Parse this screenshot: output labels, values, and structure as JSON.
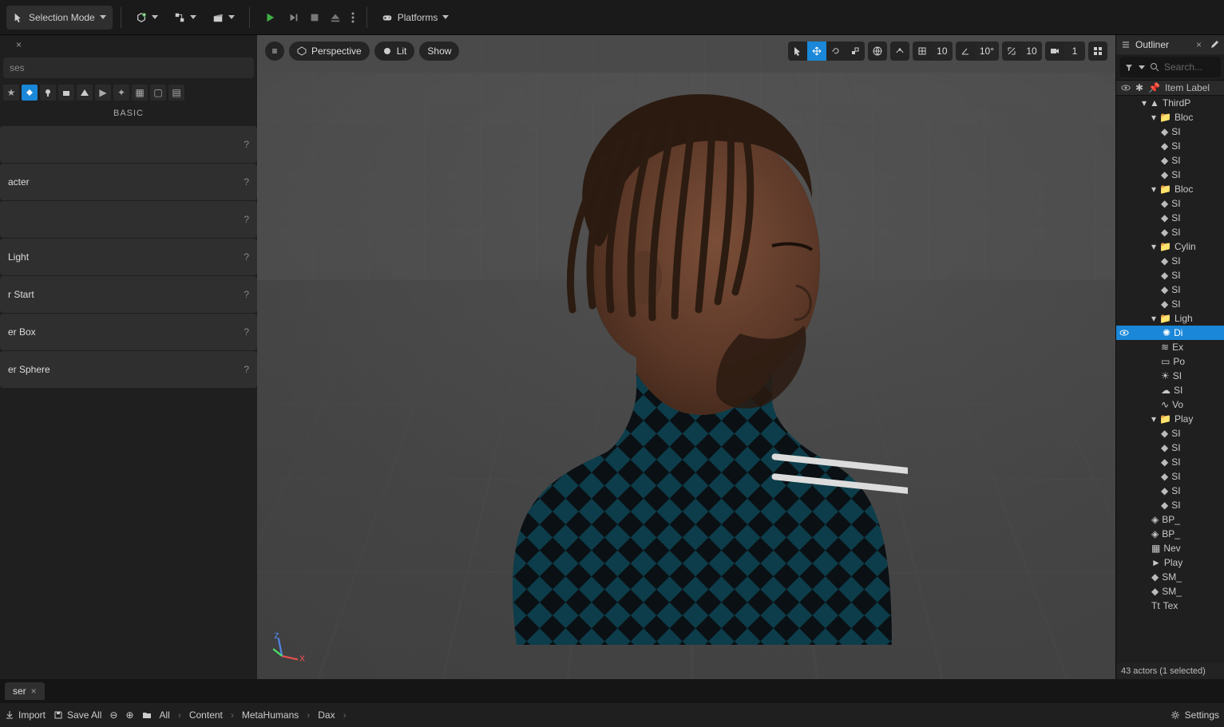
{
  "toolbar": {
    "selection_mode": "Selection Mode",
    "platforms": "Platforms"
  },
  "left_panel": {
    "tab_close": "×",
    "search_placeholder": "ses",
    "category": "BASIC",
    "items": [
      {
        "label": ""
      },
      {
        "label": "acter"
      },
      {
        "label": ""
      },
      {
        "label": "Light"
      },
      {
        "label": "r Start"
      },
      {
        "label": "er Box"
      },
      {
        "label": "er Sphere"
      }
    ]
  },
  "viewport": {
    "perspective": "Perspective",
    "lit": "Lit",
    "show": "Show",
    "snap_translate": "10",
    "snap_rotate": "10°",
    "snap_scale": "10",
    "camera_speed": "1"
  },
  "outliner": {
    "title": "Outliner",
    "search_placeholder": "Search...",
    "header": "Item Label",
    "footer": "43 actors (1 selected)",
    "tree": [
      {
        "depth": 0,
        "type": "world",
        "label": "ThirdP"
      },
      {
        "depth": 1,
        "type": "folder",
        "label": "Bloc"
      },
      {
        "depth": 2,
        "type": "mesh",
        "label": "SI"
      },
      {
        "depth": 2,
        "type": "mesh",
        "label": "SI"
      },
      {
        "depth": 2,
        "type": "mesh",
        "label": "SI"
      },
      {
        "depth": 2,
        "type": "mesh",
        "label": "SI"
      },
      {
        "depth": 1,
        "type": "folder",
        "label": "Bloc"
      },
      {
        "depth": 2,
        "type": "mesh",
        "label": "SI"
      },
      {
        "depth": 2,
        "type": "mesh",
        "label": "SI"
      },
      {
        "depth": 2,
        "type": "mesh",
        "label": "SI"
      },
      {
        "depth": 1,
        "type": "folder",
        "label": "Cylin"
      },
      {
        "depth": 2,
        "type": "mesh",
        "label": "SI"
      },
      {
        "depth": 2,
        "type": "mesh",
        "label": "SI"
      },
      {
        "depth": 2,
        "type": "mesh",
        "label": "SI"
      },
      {
        "depth": 2,
        "type": "mesh",
        "label": "SI"
      },
      {
        "depth": 1,
        "type": "folder",
        "label": "Ligh"
      },
      {
        "depth": 2,
        "type": "light",
        "label": "Di",
        "selected": true
      },
      {
        "depth": 2,
        "type": "fog",
        "label": "Ex"
      },
      {
        "depth": 2,
        "type": "psv",
        "label": "Po"
      },
      {
        "depth": 2,
        "type": "skylt",
        "label": "SI"
      },
      {
        "depth": 2,
        "type": "atmo",
        "label": "SI"
      },
      {
        "depth": 2,
        "type": "cloud",
        "label": "Vo"
      },
      {
        "depth": 1,
        "type": "folder",
        "label": "Play"
      },
      {
        "depth": 2,
        "type": "mesh",
        "label": "SI"
      },
      {
        "depth": 2,
        "type": "mesh",
        "label": "SI"
      },
      {
        "depth": 2,
        "type": "mesh",
        "label": "SI"
      },
      {
        "depth": 2,
        "type": "mesh",
        "label": "SI"
      },
      {
        "depth": 2,
        "type": "mesh",
        "label": "SI"
      },
      {
        "depth": 2,
        "type": "mesh",
        "label": "SI"
      },
      {
        "depth": 1,
        "type": "bp",
        "label": "BP_"
      },
      {
        "depth": 1,
        "type": "bp",
        "label": "BP_"
      },
      {
        "depth": 1,
        "type": "nav",
        "label": "Nev"
      },
      {
        "depth": 1,
        "type": "pawn",
        "label": "Play"
      },
      {
        "depth": 1,
        "type": "mesh",
        "label": "SM_"
      },
      {
        "depth": 1,
        "type": "mesh",
        "label": "SM_"
      },
      {
        "depth": 1,
        "type": "text",
        "label": "Tex"
      }
    ]
  },
  "content_browser": {
    "tab": "ser",
    "import": "Import",
    "save_all": "Save All",
    "breadcrumbs": [
      "All",
      "Content",
      "MetaHumans",
      "Dax"
    ],
    "settings": "Settings"
  }
}
